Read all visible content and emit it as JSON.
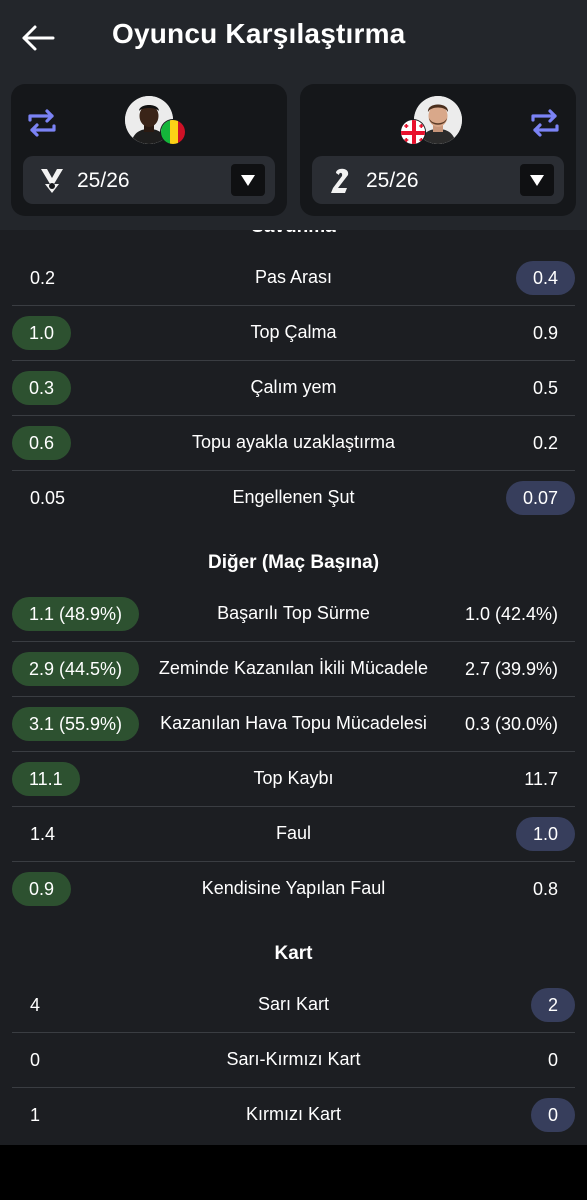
{
  "header": {
    "title": "Oyuncu Karşılaştırma"
  },
  "players": {
    "left": {
      "season": "25/26",
      "flag": "Mali"
    },
    "right": {
      "season": "25/26",
      "flag": "Georgia"
    }
  },
  "colors": {
    "accent": "#7b83f5",
    "left_highlight": "#2d5130",
    "right_highlight": "#373e5c",
    "background": "#1c1e22"
  },
  "sections": {
    "defense": {
      "title": "Savunma",
      "rows": [
        {
          "label": "Pas Arası",
          "left": "0.2",
          "right": "0.4",
          "winner": "right"
        },
        {
          "label": "Top Çalma",
          "left": "1.0",
          "right": "0.9",
          "winner": "left"
        },
        {
          "label": "Çalım yem",
          "left": "0.3",
          "right": "0.5",
          "winner": "left"
        },
        {
          "label": "Topu ayakla uzaklaştırma",
          "left": "0.6",
          "right": "0.2",
          "winner": "left"
        },
        {
          "label": "Engellenen Şut",
          "left": "0.05",
          "right": "0.07",
          "winner": "right"
        }
      ]
    },
    "other": {
      "title": "Diğer (Maç Başına)",
      "rows": [
        {
          "label": "Başarılı Top Sürme",
          "left": "1.1 (48.9%)",
          "right": "1.0 (42.4%)",
          "winner": "left"
        },
        {
          "label": "Zeminde Kazanılan İkili Mücadele",
          "left": "2.9 (44.5%)",
          "right": "2.7 (39.9%)",
          "winner": "left"
        },
        {
          "label": "Kazanılan Hava Topu Mücadelesi",
          "left": "3.1 (55.9%)",
          "right": "0.3 (30.0%)",
          "winner": "left"
        },
        {
          "label": "Top Kaybı",
          "left": "11.1",
          "right": "11.7",
          "winner": "left"
        },
        {
          "label": "Faul",
          "left": "1.4",
          "right": "1.0",
          "winner": "right"
        },
        {
          "label": "Kendisine Yapılan Faul",
          "left": "0.9",
          "right": "0.8",
          "winner": "left"
        }
      ]
    },
    "cards": {
      "title": "Kart",
      "rows": [
        {
          "label": "Sarı Kart",
          "left": "4",
          "right": "2",
          "winner": "right"
        },
        {
          "label": "Sarı-Kırmızı Kart",
          "left": "0",
          "right": "0",
          "winner": "none"
        },
        {
          "label": "Kırmızı Kart",
          "left": "1",
          "right": "0",
          "winner": "right"
        }
      ]
    }
  }
}
